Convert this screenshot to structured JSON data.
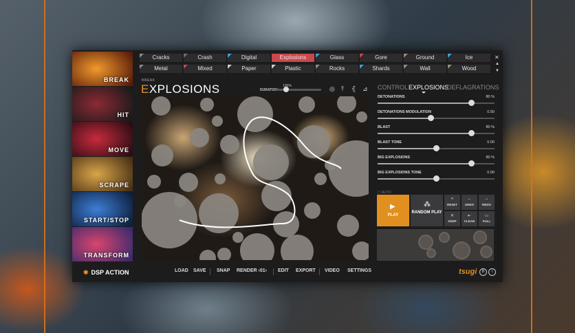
{
  "sidebar": {
    "items": [
      {
        "label": "BREAK",
        "colors": [
          "#f19a2c",
          "#5a1c0a"
        ]
      },
      {
        "label": "HIT",
        "colors": [
          "#8b2a34",
          "#1a1a1a"
        ]
      },
      {
        "label": "MOVE",
        "colors": [
          "#c72a3c",
          "#2a0d13"
        ]
      },
      {
        "label": "SCRAPE",
        "colors": [
          "#d8a54a",
          "#4a3114"
        ]
      },
      {
        "label": "START/STOP",
        "colors": [
          "#3d7fd6",
          "#0d1f3d"
        ]
      },
      {
        "label": "TRANSFORM",
        "colors": [
          "#d9456d",
          "#3b2a6e"
        ]
      }
    ]
  },
  "tabs": [
    {
      "label": "Cracks",
      "color": "#8a8a8a"
    },
    {
      "label": "Crash",
      "color": "#6e6e6e"
    },
    {
      "label": "Digital",
      "color": "#3fa1d6"
    },
    {
      "label": "Explosions",
      "color": "#c8484b",
      "active": true
    },
    {
      "label": "Glass",
      "color": "#3fa1d6"
    },
    {
      "label": "Gore",
      "color": "#c8484b"
    },
    {
      "label": "Ground",
      "color": "#9b8b75"
    },
    {
      "label": "Ice",
      "color": "#3fa1d6"
    },
    {
      "label": "Metal",
      "color": "#8a8a8a"
    },
    {
      "label": "Mixed",
      "color": "#c8484b"
    },
    {
      "label": "Paper",
      "color": "#cfcfcf"
    },
    {
      "label": "Plastic",
      "color": "#cfcfcf"
    },
    {
      "label": "Rocks",
      "color": "#8a8a8a"
    },
    {
      "label": "Shards",
      "color": "#3fa1d6"
    },
    {
      "label": "Wall",
      "color": "#9b8b75"
    },
    {
      "label": "Wood",
      "color": "#9b8b75"
    }
  ],
  "header": {
    "breadcrumb": "BREAK",
    "title_first": "E",
    "title_rest": "XPLOSIONS",
    "duration_label": "DURATION",
    "duration_value": "100%"
  },
  "right_tabs": [
    "CONTROL",
    "EXPLOSIONS",
    "DEFLAGRATIONS"
  ],
  "params": [
    {
      "label": "DETONATIONS",
      "value": "80 %",
      "level": 0.8
    },
    {
      "label": "DETONATIONS MODULATION",
      "value": "0.50",
      "level": 0.45
    },
    {
      "label": "BLAST",
      "value": "80 %",
      "level": 0.8
    },
    {
      "label": "BLAST TONE",
      "value": "0.00",
      "level": 0.5
    },
    {
      "label": "BIG EXPLOSIONS",
      "value": "80 %",
      "level": 0.8
    },
    {
      "label": "BIG EXPLOSIONS TONE",
      "value": "0.00",
      "level": 0.5
    }
  ],
  "auto_label": "AUTO",
  "play_label": "PLAY",
  "random_play_label": "RANDOM PLAY",
  "small_buttons": [
    {
      "label": "RESET",
      "icon": "«"
    },
    {
      "label": "UNDO",
      "icon": "←"
    },
    {
      "label": "REDO",
      "icon": "→"
    },
    {
      "label": "KEEP",
      "icon": "✕"
    },
    {
      "label": "CLEAR",
      "icon": "⇤"
    },
    {
      "label": "FULL",
      "icon": "▭"
    }
  ],
  "footer": {
    "brand": "DSP ACTION",
    "nav": [
      "LOAD",
      "SAVE",
      "SNAP",
      "RENDER ‹01›",
      "EDIT",
      "EXPORT",
      "VIDEO",
      "SETTINGS"
    ],
    "tsugi": "tsugi"
  },
  "colors": {
    "accent": "#e1901f",
    "active_tab": "#c8484b",
    "panel": "#1c1c1d"
  }
}
